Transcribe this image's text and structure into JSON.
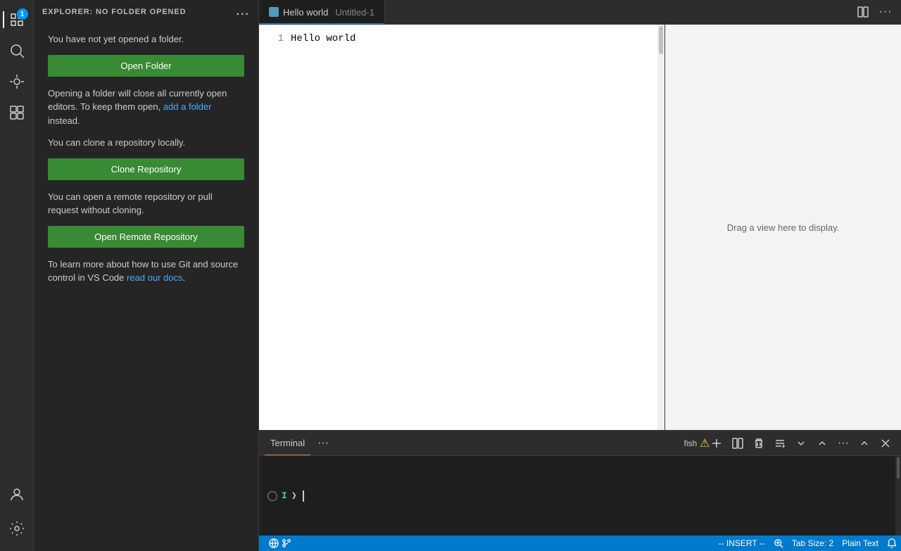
{
  "titlebar": {
    "title": ""
  },
  "sidebar": {
    "header": "Explorer: No Folder Opened",
    "overflow_icon": "...",
    "paragraph1": "You have not yet opened a folder.",
    "open_folder_btn": "Open Folder",
    "paragraph2_prefix": "Opening a folder will close all currently open editors. To keep them open, ",
    "add_folder_link": "add a folder",
    "paragraph2_suffix": " instead.",
    "paragraph3": "You can clone a repository locally.",
    "clone_repo_btn": "Clone Repository",
    "paragraph4": "You can open a remote repository or pull request without cloning.",
    "open_remote_btn": "Open Remote Repository",
    "paragraph5_prefix": "To learn more about how to use Git and source control in VS Code ",
    "read_docs_link": "read our docs",
    "paragraph5_suffix": "."
  },
  "tabs": {
    "items": [
      {
        "label": "Hello world",
        "sublabel": "Untitled-1",
        "active": true
      }
    ],
    "split_icon": "split",
    "more_icon": "..."
  },
  "editor": {
    "lines": [
      {
        "number": "1",
        "content": "Hello world"
      }
    ]
  },
  "right_panel": {
    "hint": "Drag a view here to display."
  },
  "terminal": {
    "tab_label": "Terminal",
    "tab_overflow": "...",
    "shell_name": "fish",
    "warning_icon": "⚠",
    "new_terminal_icon": "+",
    "split_icon": "split",
    "trash_icon": "trash",
    "menu_icon": "≡",
    "scroll_down_icon": "↓",
    "scroll_up_icon": "↑",
    "more_icon": "...",
    "kill_icon": "∧",
    "close_icon": "×",
    "prompt_i": "I",
    "prompt_arrow": "❯"
  },
  "statusbar": {
    "remote_icon": "remote",
    "mode": "-- INSERT --",
    "zoom_icon": "search",
    "tab_size": "Tab Size: 2",
    "language": "Plain Text",
    "bell_icon": "bell"
  }
}
